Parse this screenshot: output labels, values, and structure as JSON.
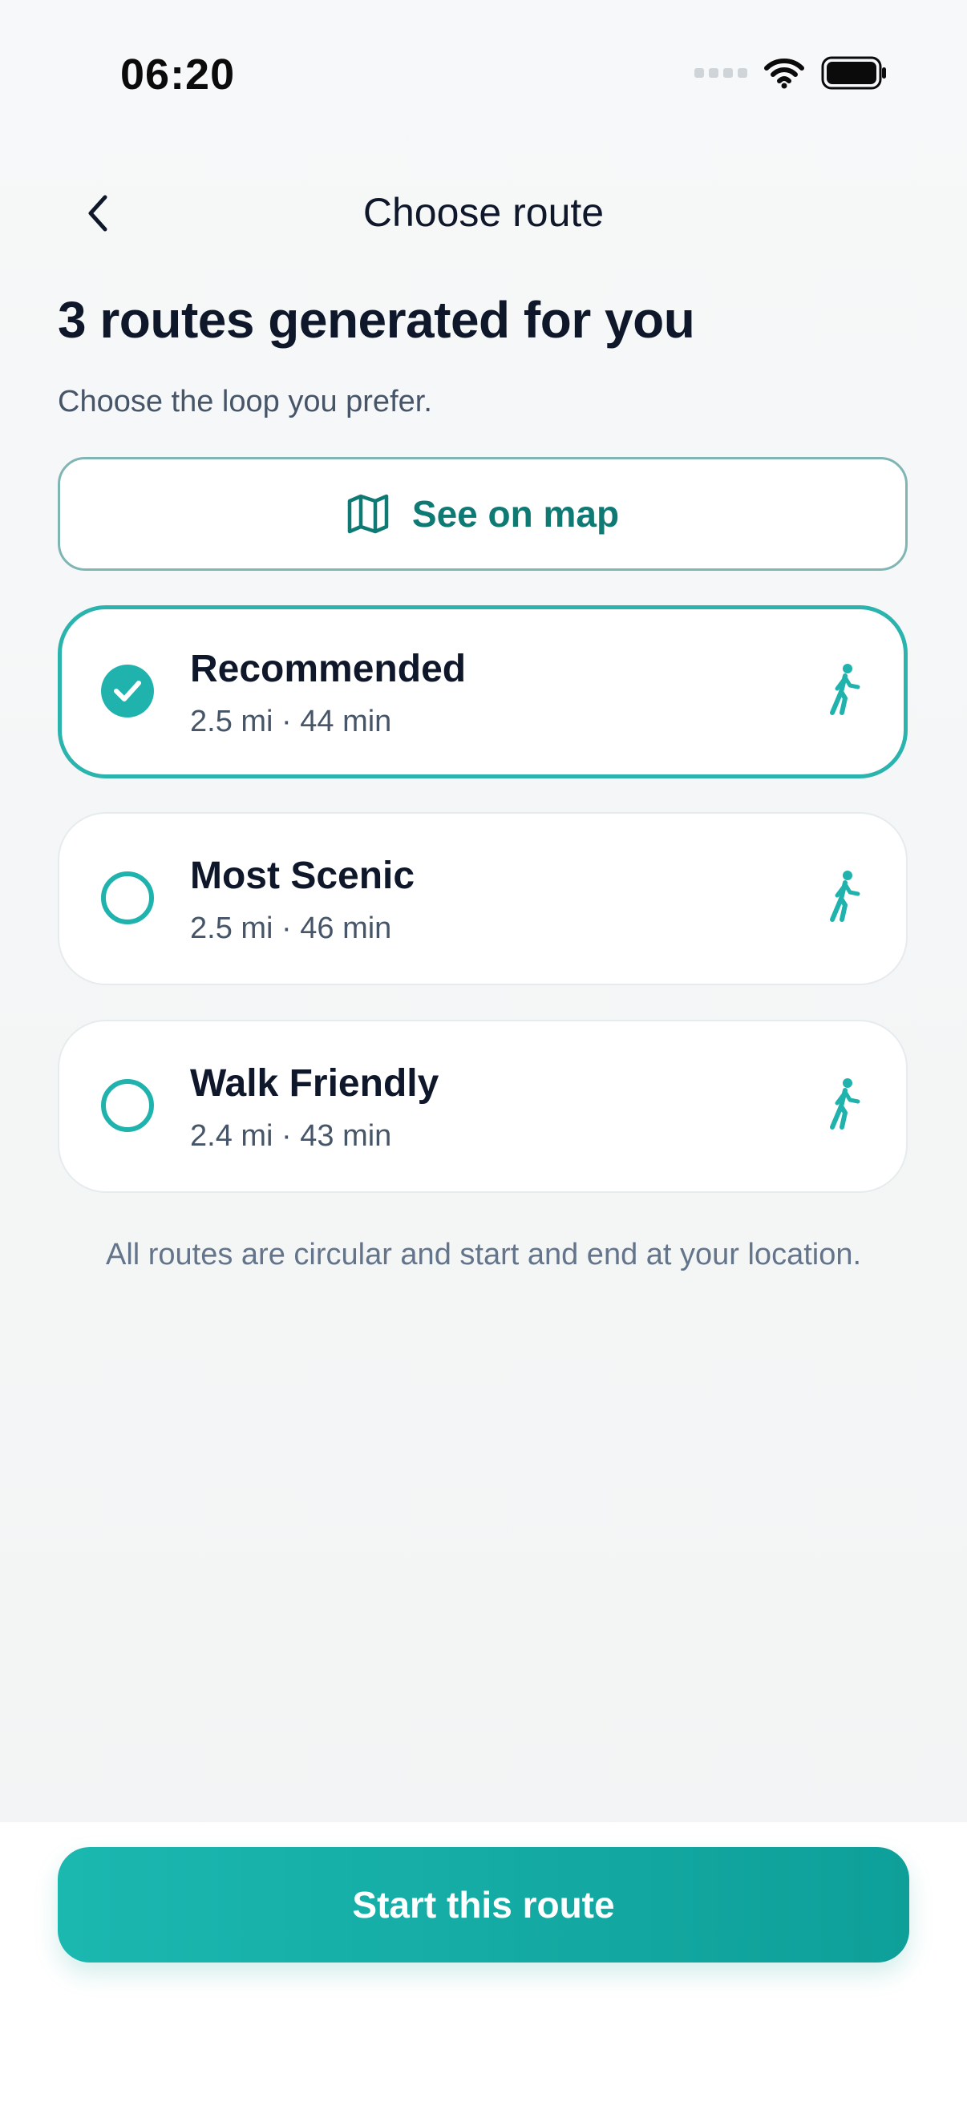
{
  "status_bar": {
    "time": "06:20"
  },
  "header": {
    "title": "Choose route"
  },
  "intro": {
    "headline": "3 routes generated for you",
    "subtitle": "Choose the loop you prefer."
  },
  "map_button": {
    "label": "See on map"
  },
  "routes": [
    {
      "name": "Recommended",
      "meta": "2.5 mi · 44 min",
      "selected": true
    },
    {
      "name": "Most Scenic",
      "meta": "2.5 mi · 46 min",
      "selected": false
    },
    {
      "name": "Walk Friendly",
      "meta": "2.4 mi · 43 min",
      "selected": false
    }
  ],
  "footnote": "All routes are circular and start and end at your location.",
  "cta": {
    "label": "Start this route"
  },
  "colors": {
    "accent": "#20b3ad",
    "accent_dark": "#0f7a74",
    "text": "#0f172a",
    "muted": "#475569"
  },
  "icons": {
    "back": "chevron-left-icon",
    "map": "map-icon",
    "walk": "walking-person-icon",
    "check": "check-icon"
  }
}
